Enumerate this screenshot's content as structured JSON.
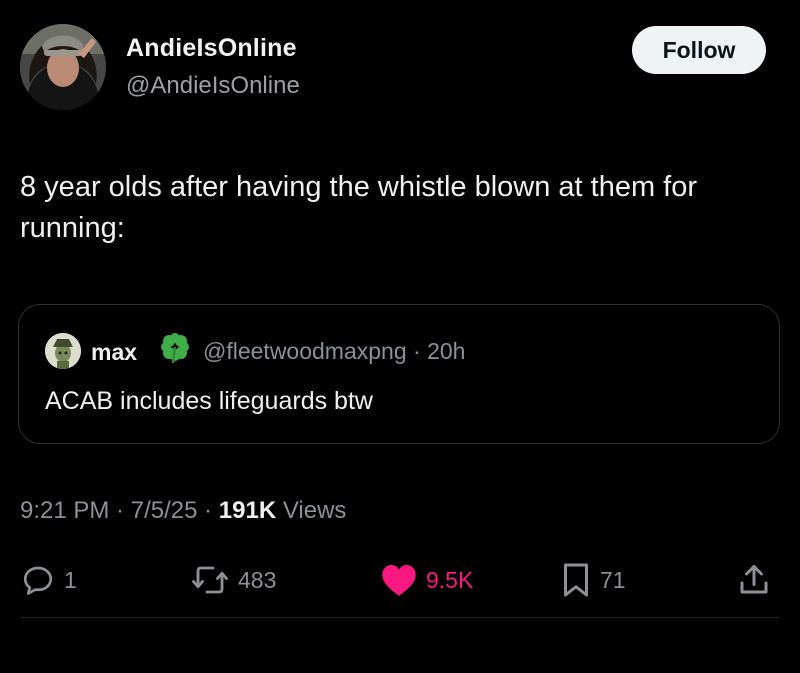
{
  "author": {
    "display_name": "AndieIsOnline",
    "handle": "@AndieIsOnline",
    "follow_label": "Follow"
  },
  "tweet": {
    "text": "8 year olds after having the whistle blown at them for running:"
  },
  "quote": {
    "name": "max",
    "name_emoji_icon": "four-leaf-clover-icon",
    "handle_time": "@fleetwoodmaxpng · 20h",
    "text": "ACAB includes lifeguards btw"
  },
  "meta": {
    "time": "9:21 PM",
    "sep1": " · ",
    "date": "7/5/25",
    "sep2": " · ",
    "views_count": "191K",
    "views_label": " Views"
  },
  "actions": {
    "replies": "1",
    "retweets": "483",
    "likes": "9.5K",
    "bookmarks": "71"
  },
  "colors": {
    "like_pink": "#f91880",
    "muted": "#8b9196",
    "background": "#000000"
  }
}
